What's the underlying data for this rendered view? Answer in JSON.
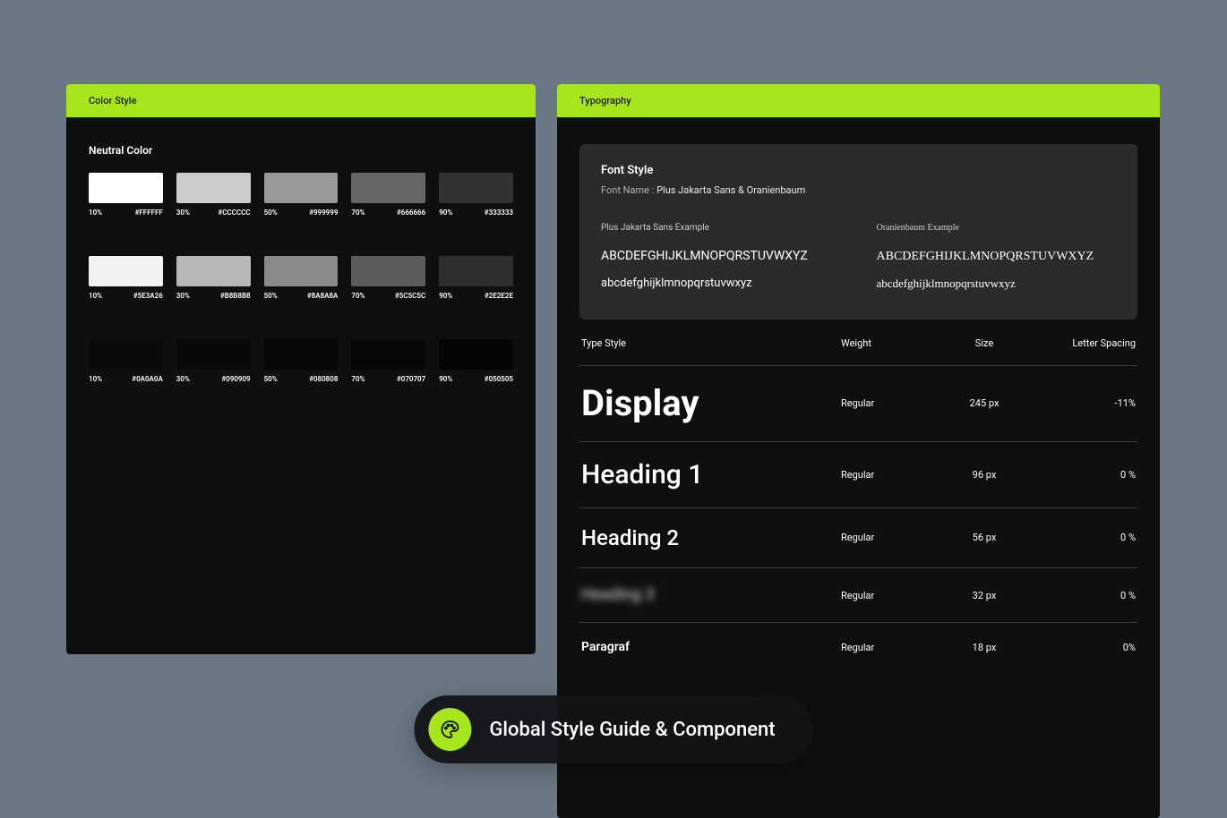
{
  "color_panel": {
    "header": "Color Style",
    "section": "Neutral Color",
    "rows": [
      [
        {
          "pct": "10%",
          "hex": "#FFFFFF",
          "c": "#FFFFFF"
        },
        {
          "pct": "30%",
          "hex": "#CCCCCC",
          "c": "#CCCCCC"
        },
        {
          "pct": "50%",
          "hex": "#999999",
          "c": "#999999"
        },
        {
          "pct": "70%",
          "hex": "#666666",
          "c": "#666666"
        },
        {
          "pct": "90%",
          "hex": "#333333",
          "c": "#333333"
        }
      ],
      [
        {
          "pct": "10%",
          "hex": "#5E3A26",
          "c": "#F2F2F2"
        },
        {
          "pct": "30%",
          "hex": "#B8B8B8",
          "c": "#B8B8B8"
        },
        {
          "pct": "50%",
          "hex": "#8A8A8A",
          "c": "#8A8A8A"
        },
        {
          "pct": "70%",
          "hex": "#5C5C5C",
          "c": "#5C5C5C"
        },
        {
          "pct": "90%",
          "hex": "#2E2E2E",
          "c": "#2E2E2E"
        }
      ],
      [
        {
          "pct": "10%",
          "hex": "#0A0A0A",
          "c": "#0A0A0A"
        },
        {
          "pct": "30%",
          "hex": "#090909",
          "c": "#090909"
        },
        {
          "pct": "50%",
          "hex": "#080808",
          "c": "#080808"
        },
        {
          "pct": "70%",
          "hex": "#070707",
          "c": "#070707"
        },
        {
          "pct": "90%",
          "hex": "#050505",
          "c": "#050505"
        }
      ]
    ]
  },
  "typo_panel": {
    "header": "Typography",
    "font_card": {
      "title": "Font Style",
      "name_pref": "Font Name :",
      "name_val": "Plus Jakarta Sans & Oranienbaum",
      "ex1_label": "Plus Jakarta Sans Example",
      "ex2_label": "Oranienbaum Example",
      "upper": "ABCDEFGHIJKLMNOPQRSTUVWXYZ",
      "lower": "abcdefghijklmnopqrstuvwxyz"
    },
    "table_head": {
      "label": "Type Style",
      "weight": "Weight",
      "size": "Size",
      "ls": "Letter Spacing"
    },
    "rows": [
      {
        "name": "Display",
        "cls": "sz-display",
        "weight": "Regular",
        "size": "245 px",
        "ls": "-11%"
      },
      {
        "name": "Heading 1",
        "cls": "sz-h1",
        "weight": "Regular",
        "size": "96 px",
        "ls": "0 %"
      },
      {
        "name": "Heading 2",
        "cls": "sz-h2",
        "weight": "Regular",
        "size": "56 px",
        "ls": "0 %"
      },
      {
        "name": "Heading 3",
        "cls": "sz-h3",
        "weight": "Regular",
        "size": "32 px",
        "ls": "0 %"
      },
      {
        "name": "Paragraf",
        "cls": "sz-p",
        "weight": "Regular",
        "size": "18 px",
        "ls": "0%"
      }
    ]
  },
  "pill_text": "Global Style Guide & Component"
}
